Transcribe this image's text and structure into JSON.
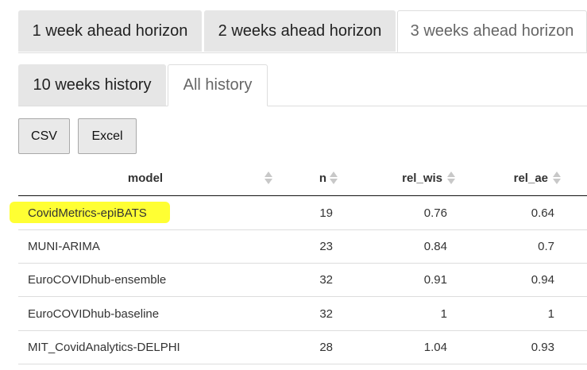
{
  "tabs_top": [
    {
      "label": "1 week ahead horizon",
      "active": false
    },
    {
      "label": "2 weeks ahead horizon",
      "active": false
    },
    {
      "label": "3 weeks ahead horizon",
      "active": true
    }
  ],
  "tabs_sub": [
    {
      "label": "10 weeks history",
      "active": false
    },
    {
      "label": "All history",
      "active": true
    }
  ],
  "buttons": {
    "csv": "CSV",
    "excel": "Excel"
  },
  "table": {
    "columns": [
      "model",
      "n",
      "rel_wis",
      "rel_ae"
    ],
    "rows": [
      {
        "model": "CovidMetrics-epiBATS",
        "n": "19",
        "rel_wis": "0.76",
        "rel_ae": "0.64",
        "highlighted": true
      },
      {
        "model": "MUNI-ARIMA",
        "n": "23",
        "rel_wis": "0.84",
        "rel_ae": "0.7"
      },
      {
        "model": "EuroCOVIDhub-ensemble",
        "n": "32",
        "rel_wis": "0.91",
        "rel_ae": "0.94"
      },
      {
        "model": "EuroCOVIDhub-baseline",
        "n": "32",
        "rel_wis": "1",
        "rel_ae": "1"
      },
      {
        "model": "MIT_CovidAnalytics-DELPHI",
        "n": "28",
        "rel_wis": "1.04",
        "rel_ae": "0.93"
      }
    ]
  },
  "colors": {
    "highlight": "#ffff33",
    "tab_inactive": "#e6e6e6",
    "border": "#dddddd"
  }
}
